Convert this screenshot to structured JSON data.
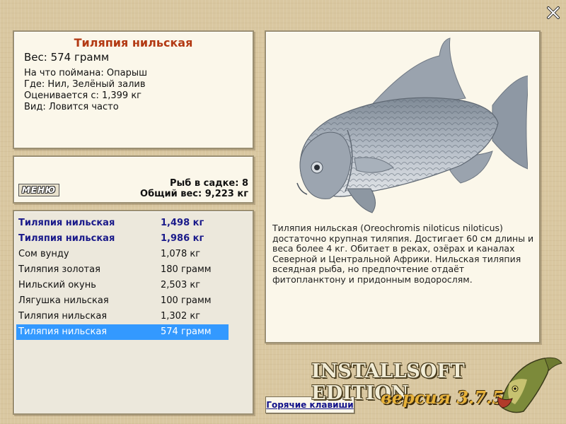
{
  "fish_info": {
    "title": "Тиляпия нильская",
    "weight": "Вес: 574 грамм",
    "bait": "На что поймана: Опарыш",
    "location": "Где: Нил, Зелёный залив",
    "valued": "Оценивается с: 1,399 кг",
    "kind": "Вид: Ловится часто"
  },
  "cage": {
    "menu_label": "МЕНЮ",
    "fish_count": "Рыб в садке: 8",
    "total_weight": "Общий вес: 9,223 кг"
  },
  "catch_list": [
    {
      "name": "Тиляпия нильская",
      "weight": "1,498 кг",
      "style": "bold"
    },
    {
      "name": "Тиляпия нильская",
      "weight": "1,986 кг",
      "style": "bold"
    },
    {
      "name": "Сом вунду",
      "weight": "1,078 кг",
      "style": "normal"
    },
    {
      "name": "Тиляпия золотая",
      "weight": "180 грамм",
      "style": "normal"
    },
    {
      "name": "Нильский окунь",
      "weight": "2,503 кг",
      "style": "normal"
    },
    {
      "name": "Лягушка нильская",
      "weight": "100 грамм",
      "style": "normal"
    },
    {
      "name": "Тиляпия нильская",
      "weight": "1,302 кг",
      "style": "normal"
    },
    {
      "name": "Тиляпия нильская",
      "weight": "574 грамм",
      "style": "selected"
    }
  ],
  "description": "Тиляпия нильская (Oreochromis niloticus niloticus) достаточно крупная тиляпия. Достигает 60 см длины и веса более 4 кг. Обитает в реках, озёрах и каналах Северной и Центральной Африки. Нильская тиляпия всеядная рыба, но предпочтение отдаёт фитопланктону и придонным водорослям.",
  "footer": {
    "hotkeys_label": "Горячие клавиши",
    "edition": "INSTALLSOFT EDITION",
    "version": "версия 3.7.5"
  },
  "icons": {
    "close": "close-icon",
    "fish_image": "tilapia-image",
    "logo": "pike-logo"
  },
  "colors": {
    "title": "#b33a14",
    "selected_row": "#3399ff",
    "bold_row": "#1a1a8a",
    "version": "#e7b23a"
  }
}
